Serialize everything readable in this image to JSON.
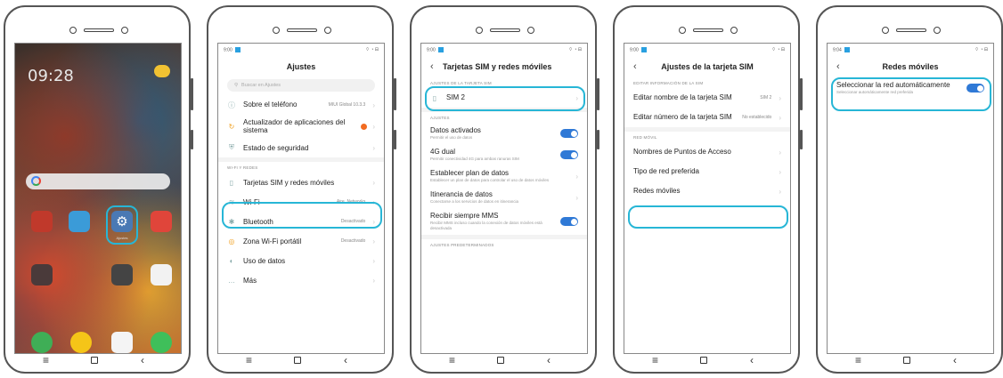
{
  "colors": {
    "highlight": "#27b6d6",
    "toggle": "#2f79d6",
    "badge": "#f26b21"
  },
  "phone1": {
    "clock": "09:28",
    "settings_app_label": "Ajustes"
  },
  "phone2": {
    "status_time": "9:00",
    "status_right": "⌔ ◔ ⊟",
    "title": "Ajustes",
    "search_placeholder": "Buscar en Ajustes",
    "section_network": "Wi-Fi y redes",
    "items": [
      {
        "label": "Sobre el teléfono",
        "value": "MIUI Global 10.3.3"
      },
      {
        "label": "Actualizador de aplicaciones del sistema",
        "value": ""
      },
      {
        "label": "Estado de seguridad",
        "value": ""
      },
      {
        "label": "Tarjetas SIM y redes móviles",
        "value": ""
      },
      {
        "label": "Wi-Fi",
        "value": "Aire_Networks"
      },
      {
        "label": "Bluetooth",
        "value": "Desactivado"
      },
      {
        "label": "Zona Wi-Fi portátil",
        "value": "Desactivado"
      },
      {
        "label": "Uso de datos",
        "value": ""
      },
      {
        "label": "Más",
        "value": ""
      }
    ]
  },
  "phone3": {
    "status_time": "9:00",
    "status_right": "⌔ ◔ ⊟",
    "title": "Tarjetas SIM y redes móviles",
    "section_sim": "Ajustes de la tarjeta SIM",
    "sim_label": "SIM 2",
    "section_settings": "Ajustes",
    "items": [
      {
        "label": "Datos activados",
        "sub": "Permitir el uso de datos"
      },
      {
        "label": "4G dual",
        "sub": "Permitir conectividad 4G para ambas ranuras SIM"
      },
      {
        "label": "Establecer plan de datos",
        "sub": "Establecer un plan de datos para controlar el uso de datos móviles"
      },
      {
        "label": "Itinerancia de datos",
        "sub": "Conectarse a los servicios de datos en itinerancia"
      },
      {
        "label": "Recibir siempre MMS",
        "sub": "Recibir MMS incluso cuando la conexión de datos móviles está desactivada"
      }
    ],
    "section_defaults": "Ajustes predeterminados"
  },
  "phone4": {
    "status_time": "9:00",
    "status_right": "⌔ ◔ ⊟",
    "title": "Ajustes de la tarjeta SIM",
    "section_edit": "Editar información de la SIM",
    "edit_name_label": "Editar nombre de la tarjeta SIM",
    "edit_name_value": "SIM 2",
    "edit_number_label": "Editar número de la tarjeta SIM",
    "edit_number_value": "No establecido",
    "section_network": "Red móvil",
    "apn_label": "Nombres de Puntos de Acceso",
    "network_type_label": "Tipo de red preferida",
    "mobile_networks_label": "Redes móviles"
  },
  "phone5": {
    "status_time": "9:04",
    "status_right": "⌔ ◔ ⊟",
    "title": "Redes móviles",
    "auto_label": "Seleccionar la red automáticamente",
    "auto_sub": "Seleccionar automáticamente red preferida"
  },
  "nav": {
    "menu": "≡",
    "back": "‹"
  }
}
